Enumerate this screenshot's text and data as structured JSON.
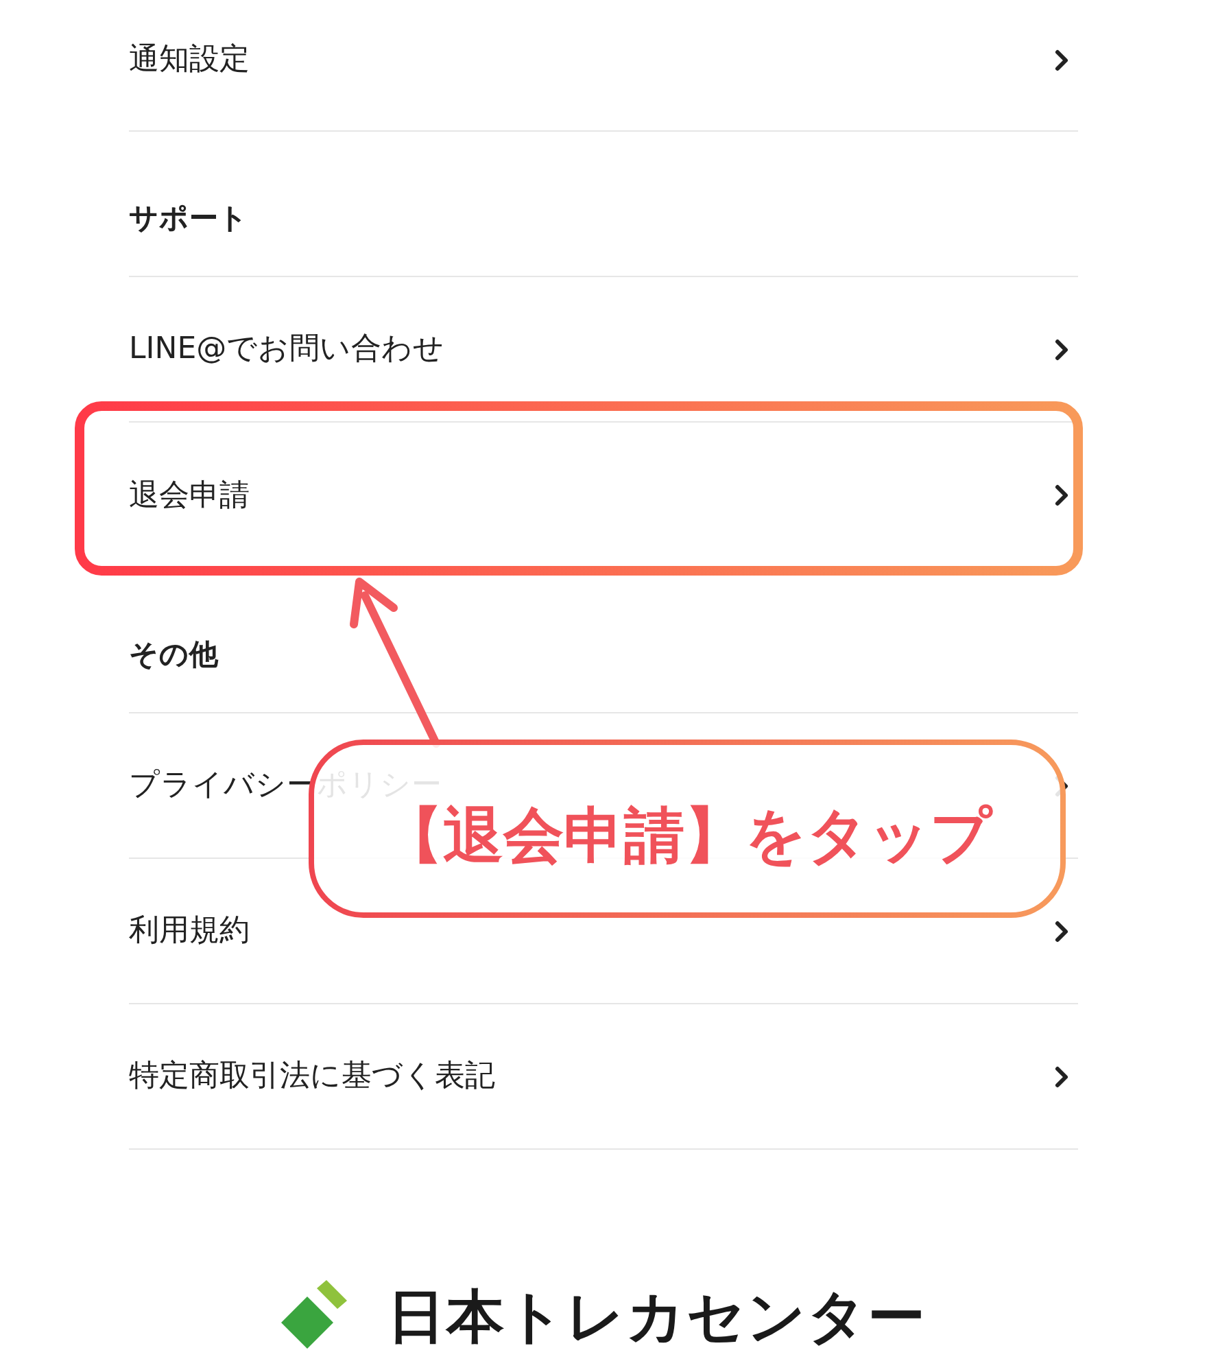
{
  "sections": [
    {
      "items": [
        {
          "label": "通知設定",
          "highlighted": false
        }
      ]
    },
    {
      "title": "サポート",
      "items": [
        {
          "label": "LINE@でお問い合わせ",
          "highlighted": false
        },
        {
          "label": "退会申請",
          "highlighted": true
        }
      ]
    },
    {
      "title": "その他",
      "items": [
        {
          "label": "プライバシーポリシー",
          "highlighted": false
        },
        {
          "label": "利用規約",
          "highlighted": false
        },
        {
          "label": "特定商取引法に基づく表記",
          "highlighted": false
        }
      ]
    }
  ],
  "callout": {
    "text": "【退会申請】をタップ"
  },
  "logo": {
    "text": "日本トレカセンター"
  }
}
